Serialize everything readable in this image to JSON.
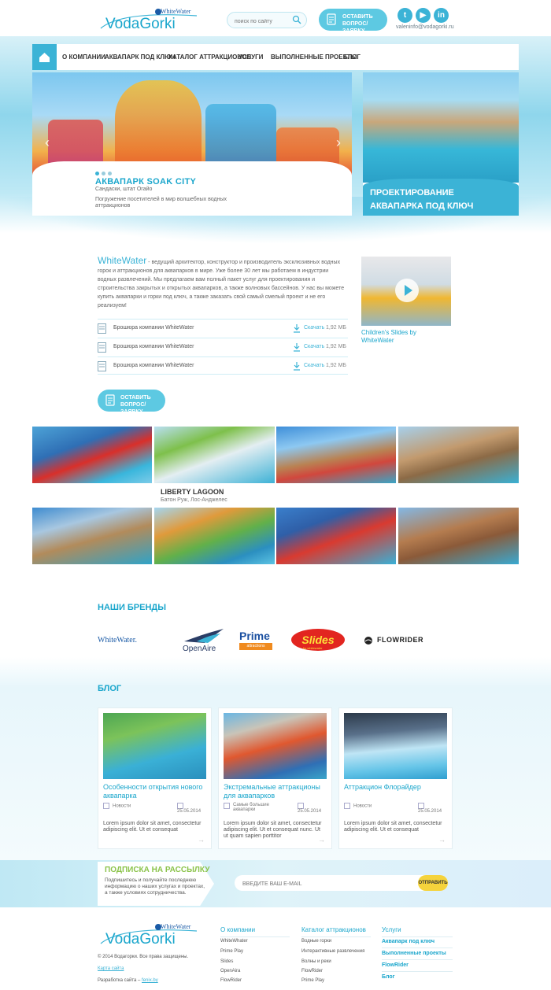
{
  "header": {
    "logo_text": "VodaGorki",
    "logo_tag": "WhiteWater",
    "search_placeholder": "поиск по сайту",
    "cta": "Оставить вопрос/заявку",
    "email": "valeninfo@vodagorki.ru",
    "social": [
      "twitter-icon",
      "youtube-icon",
      "linkedin-icon"
    ]
  },
  "nav": {
    "items": [
      "О компании",
      "Аквапарк под ключ",
      "Каталог аттракционов",
      "Услуги",
      "Выполненные проекты",
      "Блог"
    ]
  },
  "hero": {
    "title": "Аквапарк Soak City",
    "location": "Сандаски, штат Огайо",
    "description": "Погружение посетителей в мир волшебных водных аттракционов",
    "side_title": "Проектирование аквапарка под ключ"
  },
  "about": {
    "brand": "WhiteWater",
    "text": " - ведущий архитектор, конструктор и производитель эксклюзивных водных горок и аттракционов для аквапарков в мире. Уже более 30 лет мы работаем в индустрии водных развлечений. Мы предлагаем вам полный пакет услуг для проектирования и строительства закрытых и открытых аквапарков, а также волновых бассейнов. У нас вы можете купить аквапарки и горки под ключ, а также заказать свой самый смелый проект и не его реализуем!",
    "downloads": [
      {
        "name": "Брошюра компании WhiteWater",
        "link": "Скачать",
        "size": "1,92 МБ"
      },
      {
        "name": "Брошюра компании WhiteWater",
        "link": "Скачать",
        "size": "1,92 МБ"
      },
      {
        "name": "Брошюра компании WhiteWater",
        "link": "Скачать",
        "size": "1,92 МБ"
      }
    ],
    "cta": "Оставить вопрос/заявку",
    "video_caption": "Children's Slides by WhiteWater"
  },
  "gallery": {
    "caption_title": "Liberty Lagoon",
    "caption_sub": "Батон Руж, Лос-Анджелес"
  },
  "brands": {
    "title": "Наши бренды",
    "items": [
      "WhiteWater.",
      "OpenAire",
      "Prime",
      "Slides",
      "FLOWRIDER"
    ],
    "prime_tag": "attractions",
    "slides_tag": "by whitewater"
  },
  "blog": {
    "title": "Блог",
    "posts": [
      {
        "title": "Особенности открытия нового аквапарка",
        "category": "Новости",
        "date": "25.05.2014",
        "text": "Lorem ipsum dolor sit amet, consectetur adipiscing elit. Ut et consequat"
      },
      {
        "title": "Экстремальные аттракционы для аквапарков",
        "category": "Самые большие аквапарки",
        "date": "25.05.2014",
        "text": "Lorem ipsum dolor sit amet, consectetur adipiscing elit. Ut et consequat nunc. Ut ut quam sapien porttitor"
      },
      {
        "title": "Аттракцион Флорайдер",
        "category": "Новости",
        "date": "25.05.2014",
        "text": "Lorem ipsum dolor sit amet, consectetur adipiscing elit. Ut et consequat"
      }
    ]
  },
  "newsletter": {
    "title": "Подписка на рассылку",
    "text": "Подпишитесь и получайте последнюю информацию о наших услугах и проектах, а также условиях сотрудничества.",
    "placeholder": "Введите ваш e-mail",
    "button": "Отправить"
  },
  "footer": {
    "copyright": "© 2014 Водагорки. Все права защищены.",
    "sitemap": "Карта сайта",
    "dev_label": "Разработка сайта – ",
    "dev_link": "fenix.by",
    "col1": {
      "title": "О компании",
      "items": [
        "WhiteWhater",
        "Prime Play",
        "Slides",
        "OpenAira",
        "FlowRider"
      ]
    },
    "col2": {
      "title": "Каталог аттракционов",
      "items": [
        "Водные горки",
        "Интерактивные развлечения",
        "Волны и реки",
        "FlowRider",
        "Prime Play"
      ]
    },
    "col3": {
      "title": "Услуги",
      "items": [
        "Аквапарк под ключ",
        "Выполненные проекты",
        "FlowRider",
        "Блог"
      ]
    }
  },
  "colors": {
    "accent": "#3bb3d6",
    "accent_dark": "#1aa6cc",
    "newsletter_title": "#8bc34a",
    "button_yellow": "#f5d33c"
  }
}
